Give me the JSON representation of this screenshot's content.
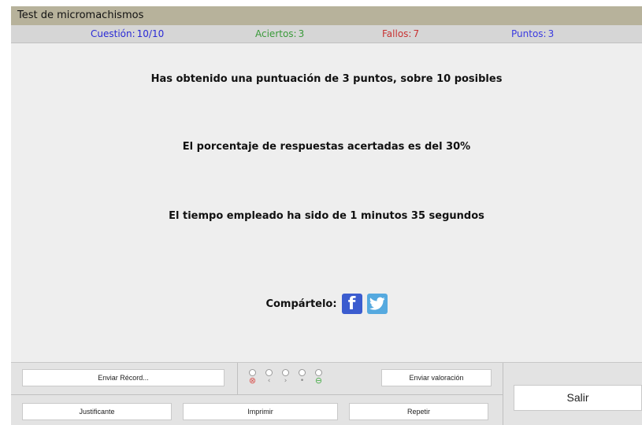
{
  "window": {
    "title": "Test de micromachismos"
  },
  "stats": {
    "question_label": "Cuestión:",
    "question_value": "10/10",
    "question_color": "#2a2ad6",
    "hits_label": "Aciertos:",
    "hits_value": "3",
    "hits_color": "#3a9a3a",
    "fails_label": "Fallos:",
    "fails_value": "7",
    "fails_color": "#c83232",
    "points_label": "Puntos:",
    "points_value": "3",
    "points_color": "#3a3ae0"
  },
  "results": {
    "score_text": "Has obtenido una puntuación de 3 puntos, sobre 10 posibles",
    "percentage_text": "El porcentaje de respuestas acertadas es del 30%",
    "time_text": "El tiempo empleado ha sido de 1 minutos 35 segundos"
  },
  "share": {
    "label": "Compártelo:",
    "facebook_icon": "facebook-icon",
    "twitter_icon": "twitter-icon",
    "facebook_glyph": "f"
  },
  "buttons": {
    "send_record": "Enviar Récord...",
    "send_rating": "Enviar valoración",
    "exit": "Salir",
    "certificate": "Justificante",
    "print": "Imprimir",
    "repeat": "Repetir"
  },
  "rating": {
    "symbols": [
      "⊗",
      "‹",
      "›",
      "•",
      "⊖"
    ]
  }
}
